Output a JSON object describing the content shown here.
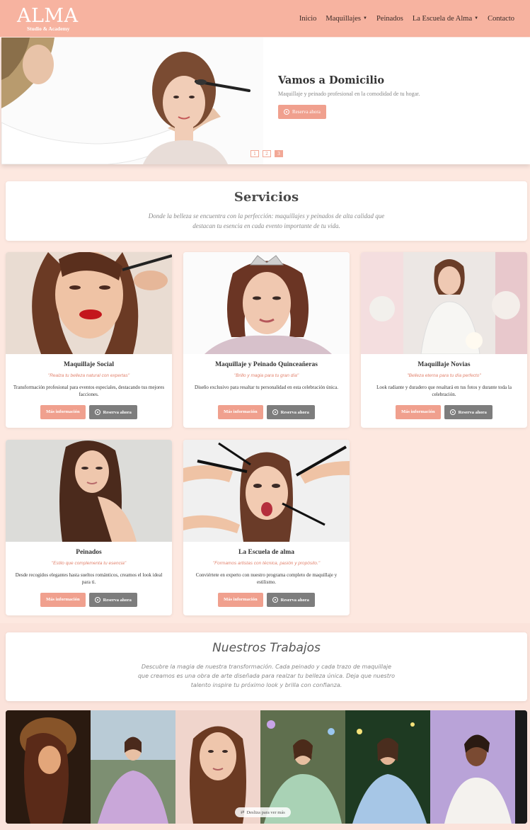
{
  "brand": {
    "logo_text": "ALMA",
    "logo_sub": "Studio & Academy"
  },
  "nav": {
    "items": [
      {
        "label": "Inicio",
        "dropdown": false
      },
      {
        "label": "Maquillajes",
        "dropdown": true
      },
      {
        "label": "Peinados",
        "dropdown": false
      },
      {
        "label": "La Escuela de Alma",
        "dropdown": true
      },
      {
        "label": "Contacto",
        "dropdown": false
      }
    ]
  },
  "hero": {
    "title": "Vamos a Domicilio",
    "subtitle": "Maquillaje y peinado profesional en la comodidad de tu hogar.",
    "button": "Reserva ahora",
    "slides": [
      "1",
      "2",
      "3"
    ],
    "active_slide": "3"
  },
  "services": {
    "title": "Servicios",
    "description": "Donde la belleza se encuentra con la perfección: maquillajes y peinados de alta calidad que destacan tu esencia en cada evento importante de tu vida.",
    "info_label": "Más información",
    "reserve_label": "Reserva ahora",
    "cards": [
      {
        "title": "Maquillaje Social",
        "tagline": "\"Realza tu belleza natural con expertas\"",
        "description": "Transformación profesional para eventos especiales, destacando tus mejores facciones."
      },
      {
        "title": "Maquillaje y Peinado Quinceañeras",
        "tagline": "\"Brillo y magia para tu gran día\"",
        "description": "Diseño exclusivo para resaltar tu personalidad en esta celebración única."
      },
      {
        "title": "Maquillaje Novias",
        "tagline": "\"Belleza eterna para tu día perfecto\"",
        "description": "Look radiante y duradero que resaltará en tus fotos y durante toda la celebración."
      },
      {
        "title": "Peinados",
        "tagline": "\"Estilo que complementa tu esencia\"",
        "description": "Desde recogidos elegantes hasta sueltos románticos, creamos el look ideal para ti."
      },
      {
        "title": "La Escuela de alma",
        "tagline": "\"Formamos artistas con técnica, pasión y propósito.\"",
        "description": "Conviértete en experto con nuestro programa completo de maquillaje y estilismo."
      }
    ]
  },
  "works": {
    "title": "Nuestros Trabajos",
    "description": "Descubre la magia de nuestra transformación. Cada peinado y cada trazo de maquillaje que creamos es una obra de arte diseñada para realzar tu belleza única. Deja que nuestro talento inspire tu próximo look y brilla con confianza.",
    "swipe_hint": "Desliza para ver más"
  },
  "colors": {
    "nav_bg": "#f7b3a0",
    "accent": "#f0a08e",
    "page_bg": "#fde8e0",
    "secondary_btn": "#7d7d7d"
  }
}
